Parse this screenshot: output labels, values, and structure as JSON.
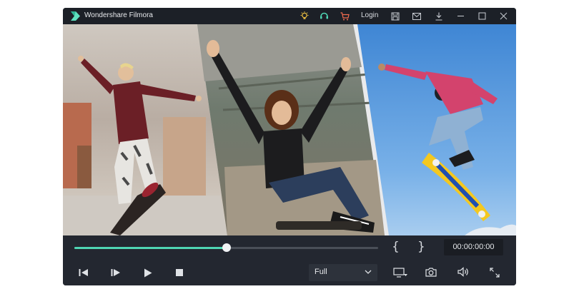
{
  "window": {
    "title": "Wondershare Filmora"
  },
  "titlebar": {
    "icons": [
      "lightbulb-icon",
      "support-icon",
      "cart-icon"
    ],
    "login_label": "Login",
    "right_icons": [
      "save-icon",
      "mail-icon",
      "download-icon",
      "minimize-icon",
      "maximize-icon",
      "close-icon"
    ]
  },
  "player": {
    "progress": 0.5,
    "mark_in": "{",
    "mark_out": "}",
    "timecode": "00:00:00:00",
    "quality": {
      "selected": "Full"
    },
    "buttons": [
      "previous-frame",
      "next-frame",
      "play",
      "stop",
      "display-settings",
      "snapshot",
      "volume",
      "fullscreen"
    ]
  },
  "colors": {
    "accent": "#4fd6b4",
    "window_bg": "#1e2229",
    "cart": "#f26b4f",
    "bulb": "#f5c542",
    "support": "#4fd6b4"
  }
}
